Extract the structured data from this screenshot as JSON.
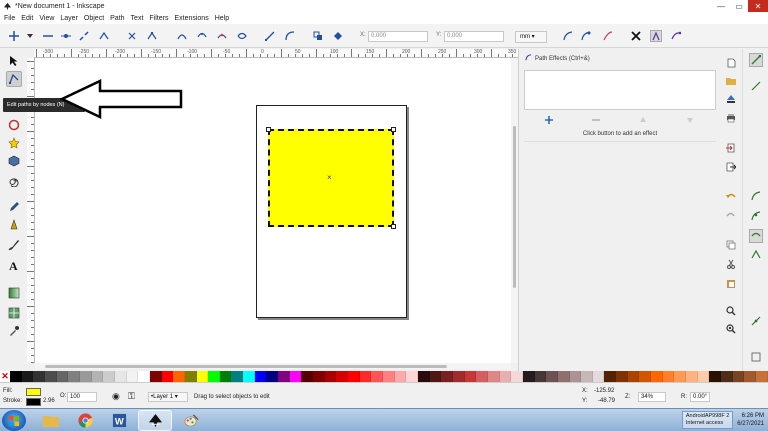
{
  "window": {
    "title": "*New document 1 - Inkscape",
    "minimize_glyph": "—",
    "maximize_glyph": "▭",
    "close_glyph": "✕"
  },
  "menu": [
    "File",
    "Edit",
    "View",
    "Layer",
    "Object",
    "Path",
    "Text",
    "Filters",
    "Extensions",
    "Help"
  ],
  "tool_controls": {
    "x_label": "X:",
    "x_value": "0.000",
    "y_label": "Y:",
    "y_value": "0.000",
    "units": "mm"
  },
  "ruler": {
    "h_labels": [
      "-300",
      "-250",
      "-200",
      "-150",
      "-100",
      "-50",
      "0",
      "50",
      "100",
      "150",
      "200",
      "250",
      "300",
      "350"
    ]
  },
  "tooltip": {
    "text": "Edit paths by nodes (N)"
  },
  "panel": {
    "title": "Path Effects (Ctrl+&)",
    "hint": "Click button to add an effect"
  },
  "palette": {
    "colors": [
      "#000000",
      "#1a1a1a",
      "#333333",
      "#4d4d4d",
      "#666666",
      "#808080",
      "#999999",
      "#b3b3b3",
      "#cccccc",
      "#e6e6e6",
      "#f2f2f2",
      "#ffffff",
      "#800000",
      "#ff0000",
      "#ff6600",
      "#808000",
      "#ffff00",
      "#00ff00",
      "#008000",
      "#008080",
      "#00ffff",
      "#0000ff",
      "#000080",
      "#800080",
      "#ff00ff",
      "#550000",
      "#800000",
      "#aa0000",
      "#d40000",
      "#ff0000",
      "#ff2a2a",
      "#ff5555",
      "#ff8080",
      "#ffaaaa",
      "#ffd5d5",
      "#280b0b",
      "#501616",
      "#782121",
      "#a02c2c",
      "#c83737",
      "#d35f5f",
      "#de8787",
      "#e9afaf",
      "#f4d7d7",
      "#241c1c",
      "#483737",
      "#6c5353",
      "#916f6f",
      "#ac9393",
      "#c8b7b7",
      "#e3dbdb",
      "#552200",
      "#803300",
      "#aa4400",
      "#d45500",
      "#ff6600",
      "#ff7f2a",
      "#ff9955",
      "#ffb380",
      "#ffccaa",
      "#2b1100",
      "#502d16",
      "#784421",
      "#a05a2c",
      "#c87137"
    ]
  },
  "status": {
    "fill_label": "Fill:",
    "stroke_label": "Stroke:",
    "fill_color": "#ffff00",
    "stroke_color": "#000000",
    "stroke_width": "2.96",
    "opacity_label": "O:",
    "opacity_value": "100",
    "layer": "•Layer 1",
    "message": "Drag to select objects to edit",
    "x_label": "X:",
    "x_value": "-125.92",
    "y_label": "Y:",
    "y_value": "-48.79",
    "zoom_label": "Z:",
    "zoom_value": "34%",
    "rotate_label": "R:",
    "rotate_value": "0.00°"
  },
  "taskbar": {
    "network_name": "AndroidAP998F 2",
    "network_status": "Internet access",
    "time": "6:26 PM",
    "date": "6/27/2021"
  }
}
